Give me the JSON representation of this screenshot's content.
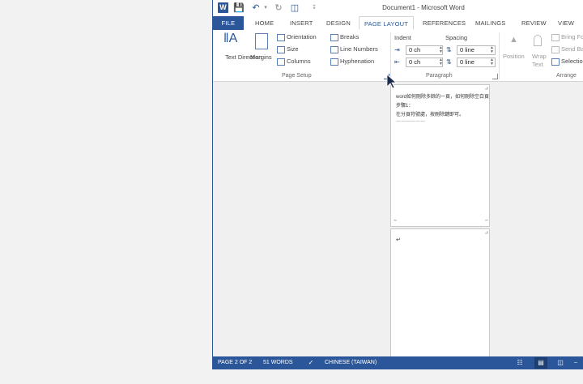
{
  "title_bar": {
    "document_title": "Document1 - Microsoft Word",
    "app_icon_letter": "W"
  },
  "tabs": [
    {
      "label": "FILE"
    },
    {
      "label": "HOME"
    },
    {
      "label": "INSERT"
    },
    {
      "label": "DESIGN"
    },
    {
      "label": "PAGE LAYOUT"
    },
    {
      "label": "REFERENCES"
    },
    {
      "label": "MAILINGS"
    },
    {
      "label": "REVIEW"
    },
    {
      "label": "VIEW"
    }
  ],
  "ribbon": {
    "page_setup": {
      "group_label": "Page Setup",
      "text_direction": "Text Direction",
      "margins": "Margins",
      "orientation": "Orientation",
      "size": "Size",
      "columns": "Columns",
      "breaks": "Breaks",
      "line_numbers": "Line Numbers",
      "hyphenation": "Hyphenation"
    },
    "paragraph": {
      "group_label": "Paragraph",
      "indent_label": "Indent",
      "spacing_label": "Spacing",
      "indent_left": "0 ch",
      "indent_right": "0 ch",
      "spacing_before": "0 line",
      "spacing_after": "0 line"
    },
    "arrange": {
      "group_label": "Arrange",
      "position": "Position",
      "wrap_text": "Wrap Text",
      "bring_forward": "Bring Fo",
      "send_backward": "Send Ba",
      "selection": "Selection"
    }
  },
  "document": {
    "page1_lines": [
      "word如何刪除多餘的一頁，如何刪除空白頁",
      "步驟1：",
      "在分頁符號處，按刪除鍵即可。",
      "………………"
    ],
    "page2_text": "↵"
  },
  "status_bar": {
    "page": "PAGE 2 OF 2",
    "words": "51 WORDS",
    "language": "CHINESE (TAIWAN)"
  },
  "colors": {
    "accent": "#2b579a"
  }
}
